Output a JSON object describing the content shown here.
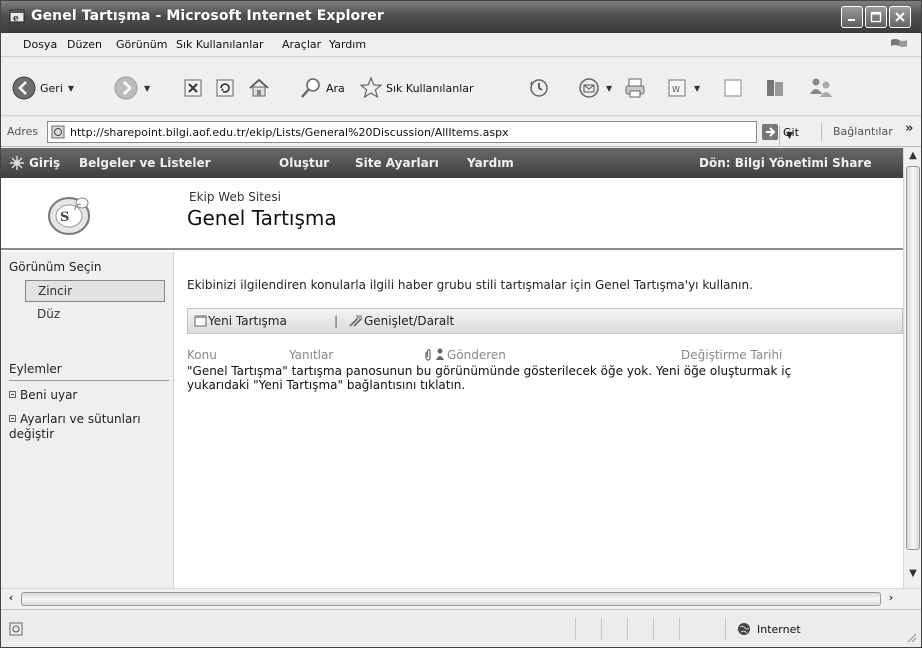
{
  "window": {
    "title": "Genel Tartışma - Microsoft Internet Explorer"
  },
  "menu": [
    "Dosya",
    "Düzen",
    "Görünüm",
    "Sık Kullanılanlar",
    "Araçlar",
    "Yardım"
  ],
  "toolbar": {
    "back_label": "Geri",
    "search_label": "Ara",
    "favorites_label": "Sık Kullanılanlar"
  },
  "address": {
    "label": "Adres",
    "url": "http://sharepoint.bilgi.aof.edu.tr/ekip/Lists/General%20Discussion/AllItems.aspx",
    "go_label": "Git",
    "links_label": "Bağlantılar",
    "links_chevron": "»"
  },
  "sharepoint": {
    "nav": [
      "Giriş",
      "Belgeler ve Listeler",
      "Oluştur",
      "Site Ayarları",
      "Yardım"
    ],
    "return_link": "Dön: Bilgi Yönetimi Share",
    "site_name": "Ekip Web Sitesi",
    "page_title": "Genel Tartışma",
    "sidebar": {
      "views_heading": "Görünüm Seçin",
      "views": [
        "Zincir",
        "Düz"
      ],
      "actions_heading": "Eylemler",
      "actions": [
        "Beni uyar",
        "Ayarları ve sütunları değiştir"
      ]
    },
    "main": {
      "intro": "Ekibinizi ilgilendiren konularla ilgili haber grubu stili tartışmalar için Genel Tartışma'yı kullanın.",
      "new_discussion": "Yeni Tartışma",
      "separator": "|",
      "expand_collapse": "Genişlet/Daralt",
      "columns": [
        "Konu",
        "Yanıtlar",
        "Gönderen",
        "Değiştirme Tarihi"
      ],
      "empty_line1": "\"Genel Tartışma\" tartışma panosunun bu görünümünde gösterilecek öğe yok. Yeni öğe oluşturmak iç",
      "empty_line2": "yukarıdaki \"Yeni Tartışma\" bağlantısını tıklatın."
    }
  },
  "status": {
    "zone": "Internet"
  }
}
